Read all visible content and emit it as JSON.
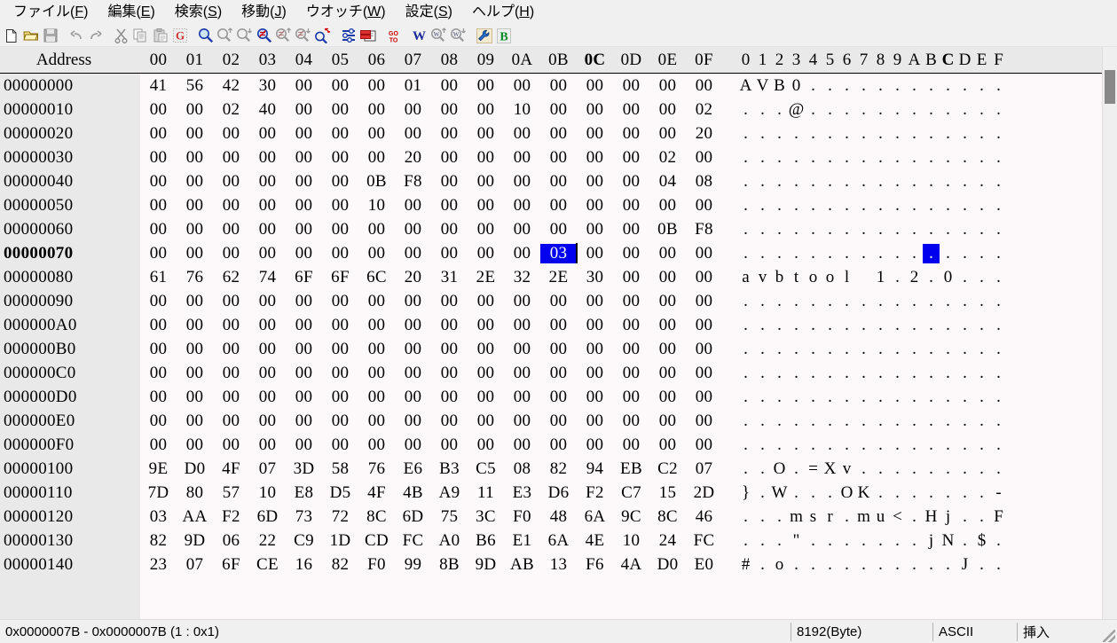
{
  "menu": {
    "items": [
      {
        "label": "ファイル(F)",
        "pre": "ファイル(",
        "mnemonic": "F",
        "post": ")"
      },
      {
        "label": "編集(E)",
        "pre": "編集(",
        "mnemonic": "E",
        "post": ")"
      },
      {
        "label": "検索(S)",
        "pre": "検索(",
        "mnemonic": "S",
        "post": ")"
      },
      {
        "label": "移動(J)",
        "pre": "移動(",
        "mnemonic": "J",
        "post": ")"
      },
      {
        "label": "ウオッチ(W)",
        "pre": "ウオッチ(",
        "mnemonic": "W",
        "post": ")"
      },
      {
        "label": "設定(S)",
        "pre": "設定(",
        "mnemonic": "S",
        "post": ")"
      },
      {
        "label": "ヘルプ(H)",
        "pre": "ヘルプ(",
        "mnemonic": "H",
        "post": ")"
      }
    ]
  },
  "toolbar": {
    "buttons": [
      {
        "icon": "new-file-icon",
        "enabled": true
      },
      {
        "icon": "open-folder-icon",
        "enabled": true
      },
      {
        "icon": "save-icon",
        "enabled": false
      },
      {
        "icon": "undo-icon",
        "enabled": false
      },
      {
        "icon": "redo-icon",
        "enabled": false
      },
      {
        "icon": "cut-icon",
        "enabled": false
      },
      {
        "icon": "copy-icon",
        "enabled": false
      },
      {
        "icon": "paste-icon",
        "enabled": false
      },
      {
        "icon": "grep-g-icon",
        "enabled": false
      },
      {
        "icon": "search-icon",
        "enabled": true
      },
      {
        "icon": "search-up-icon",
        "enabled": false
      },
      {
        "icon": "search-down-icon",
        "enabled": false
      },
      {
        "icon": "search-diff-icon",
        "enabled": true
      },
      {
        "icon": "search-diff-up-icon",
        "enabled": false
      },
      {
        "icon": "search-diff-down-icon",
        "enabled": false
      },
      {
        "icon": "search-replace-icon",
        "enabled": true
      },
      {
        "icon": "compare-lines-icon",
        "enabled": true
      },
      {
        "icon": "insert-block-icon",
        "enabled": true
      },
      {
        "icon": "goto-icon",
        "enabled": true
      },
      {
        "icon": "watch-w-icon",
        "enabled": true
      },
      {
        "icon": "watch-prev-icon",
        "enabled": false
      },
      {
        "icon": "watch-next-icon",
        "enabled": false
      },
      {
        "icon": "settings-wrench-icon",
        "enabled": true
      },
      {
        "icon": "binary-b-icon",
        "enabled": true
      }
    ]
  },
  "hexview": {
    "address_header": "Address",
    "column_headers": [
      "00",
      "01",
      "02",
      "03",
      "04",
      "05",
      "06",
      "07",
      "08",
      "09",
      "0A",
      "0B",
      "0C",
      "0D",
      "0E",
      "0F"
    ],
    "ascii_header": [
      "0",
      "1",
      "2",
      "3",
      "4",
      "5",
      "6",
      "7",
      "8",
      "9",
      "A",
      "B",
      "C",
      "D",
      "E",
      "F"
    ],
    "current_column_index": 12,
    "cursor": {
      "row_index": 7,
      "byte_index": 11,
      "address": "0x0000007B"
    },
    "rows": [
      {
        "addr": "00000000",
        "bytes": [
          "41",
          "56",
          "42",
          "30",
          "00",
          "00",
          "00",
          "01",
          "00",
          "00",
          "00",
          "00",
          "00",
          "00",
          "00",
          "00"
        ],
        "ascii": [
          "A",
          "V",
          "B",
          "0",
          ".",
          ".",
          ".",
          ".",
          ".",
          ".",
          ".",
          ".",
          ".",
          ".",
          ".",
          "."
        ]
      },
      {
        "addr": "00000010",
        "bytes": [
          "00",
          "00",
          "02",
          "40",
          "00",
          "00",
          "00",
          "00",
          "00",
          "00",
          "10",
          "00",
          "00",
          "00",
          "00",
          "02"
        ],
        "ascii": [
          ".",
          ".",
          ".",
          "@",
          ".",
          ".",
          ".",
          ".",
          ".",
          ".",
          ".",
          ".",
          ".",
          ".",
          ".",
          "."
        ]
      },
      {
        "addr": "00000020",
        "bytes": [
          "00",
          "00",
          "00",
          "00",
          "00",
          "00",
          "00",
          "00",
          "00",
          "00",
          "00",
          "00",
          "00",
          "00",
          "00",
          "20"
        ],
        "ascii": [
          ".",
          ".",
          ".",
          ".",
          ".",
          ".",
          ".",
          ".",
          ".",
          ".",
          ".",
          ".",
          ".",
          ".",
          ".",
          "."
        ]
      },
      {
        "addr": "00000030",
        "bytes": [
          "00",
          "00",
          "00",
          "00",
          "00",
          "00",
          "00",
          "20",
          "00",
          "00",
          "00",
          "00",
          "00",
          "00",
          "02",
          "00"
        ],
        "ascii": [
          ".",
          ".",
          ".",
          ".",
          ".",
          ".",
          ".",
          ".",
          ".",
          ".",
          ".",
          ".",
          ".",
          ".",
          ".",
          "."
        ]
      },
      {
        "addr": "00000040",
        "bytes": [
          "00",
          "00",
          "00",
          "00",
          "00",
          "00",
          "0B",
          "F8",
          "00",
          "00",
          "00",
          "00",
          "00",
          "00",
          "04",
          "08"
        ],
        "ascii": [
          ".",
          ".",
          ".",
          ".",
          ".",
          ".",
          ".",
          ".",
          ".",
          ".",
          ".",
          ".",
          ".",
          ".",
          ".",
          "."
        ]
      },
      {
        "addr": "00000050",
        "bytes": [
          "00",
          "00",
          "00",
          "00",
          "00",
          "00",
          "10",
          "00",
          "00",
          "00",
          "00",
          "00",
          "00",
          "00",
          "00",
          "00"
        ],
        "ascii": [
          ".",
          ".",
          ".",
          ".",
          ".",
          ".",
          ".",
          ".",
          ".",
          ".",
          ".",
          ".",
          ".",
          ".",
          ".",
          "."
        ]
      },
      {
        "addr": "00000060",
        "bytes": [
          "00",
          "00",
          "00",
          "00",
          "00",
          "00",
          "00",
          "00",
          "00",
          "00",
          "00",
          "00",
          "00",
          "00",
          "0B",
          "F8"
        ],
        "ascii": [
          ".",
          ".",
          ".",
          ".",
          ".",
          ".",
          ".",
          ".",
          ".",
          ".",
          ".",
          ".",
          ".",
          ".",
          ".",
          "."
        ]
      },
      {
        "addr": "00000070",
        "bytes": [
          "00",
          "00",
          "00",
          "00",
          "00",
          "00",
          "00",
          "00",
          "00",
          "00",
          "00",
          "03",
          "00",
          "00",
          "00",
          "00"
        ],
        "ascii": [
          ".",
          ".",
          ".",
          ".",
          ".",
          ".",
          ".",
          ".",
          ".",
          ".",
          ".",
          ".",
          ".",
          ".",
          ".",
          "."
        ]
      },
      {
        "addr": "00000080",
        "bytes": [
          "61",
          "76",
          "62",
          "74",
          "6F",
          "6F",
          "6C",
          "20",
          "31",
          "2E",
          "32",
          "2E",
          "30",
          "00",
          "00",
          "00"
        ],
        "ascii": [
          "a",
          "v",
          "b",
          "t",
          "o",
          "o",
          "l",
          " ",
          "1",
          ".",
          "2",
          ".",
          "0",
          ".",
          ".",
          "."
        ]
      },
      {
        "addr": "00000090",
        "bytes": [
          "00",
          "00",
          "00",
          "00",
          "00",
          "00",
          "00",
          "00",
          "00",
          "00",
          "00",
          "00",
          "00",
          "00",
          "00",
          "00"
        ],
        "ascii": [
          ".",
          ".",
          ".",
          ".",
          ".",
          ".",
          ".",
          ".",
          ".",
          ".",
          ".",
          ".",
          ".",
          ".",
          ".",
          "."
        ]
      },
      {
        "addr": "000000A0",
        "bytes": [
          "00",
          "00",
          "00",
          "00",
          "00",
          "00",
          "00",
          "00",
          "00",
          "00",
          "00",
          "00",
          "00",
          "00",
          "00",
          "00"
        ],
        "ascii": [
          ".",
          ".",
          ".",
          ".",
          ".",
          ".",
          ".",
          ".",
          ".",
          ".",
          ".",
          ".",
          ".",
          ".",
          ".",
          "."
        ]
      },
      {
        "addr": "000000B0",
        "bytes": [
          "00",
          "00",
          "00",
          "00",
          "00",
          "00",
          "00",
          "00",
          "00",
          "00",
          "00",
          "00",
          "00",
          "00",
          "00",
          "00"
        ],
        "ascii": [
          ".",
          ".",
          ".",
          ".",
          ".",
          ".",
          ".",
          ".",
          ".",
          ".",
          ".",
          ".",
          ".",
          ".",
          ".",
          "."
        ]
      },
      {
        "addr": "000000C0",
        "bytes": [
          "00",
          "00",
          "00",
          "00",
          "00",
          "00",
          "00",
          "00",
          "00",
          "00",
          "00",
          "00",
          "00",
          "00",
          "00",
          "00"
        ],
        "ascii": [
          ".",
          ".",
          ".",
          ".",
          ".",
          ".",
          ".",
          ".",
          ".",
          ".",
          ".",
          ".",
          ".",
          ".",
          ".",
          "."
        ]
      },
      {
        "addr": "000000D0",
        "bytes": [
          "00",
          "00",
          "00",
          "00",
          "00",
          "00",
          "00",
          "00",
          "00",
          "00",
          "00",
          "00",
          "00",
          "00",
          "00",
          "00"
        ],
        "ascii": [
          ".",
          ".",
          ".",
          ".",
          ".",
          ".",
          ".",
          ".",
          ".",
          ".",
          ".",
          ".",
          ".",
          ".",
          ".",
          "."
        ]
      },
      {
        "addr": "000000E0",
        "bytes": [
          "00",
          "00",
          "00",
          "00",
          "00",
          "00",
          "00",
          "00",
          "00",
          "00",
          "00",
          "00",
          "00",
          "00",
          "00",
          "00"
        ],
        "ascii": [
          ".",
          ".",
          ".",
          ".",
          ".",
          ".",
          ".",
          ".",
          ".",
          ".",
          ".",
          ".",
          ".",
          ".",
          ".",
          "."
        ]
      },
      {
        "addr": "000000F0",
        "bytes": [
          "00",
          "00",
          "00",
          "00",
          "00",
          "00",
          "00",
          "00",
          "00",
          "00",
          "00",
          "00",
          "00",
          "00",
          "00",
          "00"
        ],
        "ascii": [
          ".",
          ".",
          ".",
          ".",
          ".",
          ".",
          ".",
          ".",
          ".",
          ".",
          ".",
          ".",
          ".",
          ".",
          ".",
          "."
        ]
      },
      {
        "addr": "00000100",
        "bytes": [
          "9E",
          "D0",
          "4F",
          "07",
          "3D",
          "58",
          "76",
          "E6",
          "B3",
          "C5",
          "08",
          "82",
          "94",
          "EB",
          "C2",
          "07"
        ],
        "ascii": [
          ".",
          ".",
          "O",
          ".",
          "=",
          "X",
          "v",
          ".",
          ".",
          ".",
          ".",
          ".",
          ".",
          ".",
          ".",
          "."
        ]
      },
      {
        "addr": "00000110",
        "bytes": [
          "7D",
          "80",
          "57",
          "10",
          "E8",
          "D5",
          "4F",
          "4B",
          "A9",
          "11",
          "E3",
          "D6",
          "F2",
          "C7",
          "15",
          "2D"
        ],
        "ascii": [
          "}",
          ".",
          "W",
          ".",
          ".",
          ".",
          "O",
          "K",
          ".",
          ".",
          ".",
          ".",
          ".",
          ".",
          ".",
          "-"
        ]
      },
      {
        "addr": "00000120",
        "bytes": [
          "03",
          "AA",
          "F2",
          "6D",
          "73",
          "72",
          "8C",
          "6D",
          "75",
          "3C",
          "F0",
          "48",
          "6A",
          "9C",
          "8C",
          "46"
        ],
        "ascii": [
          ".",
          ".",
          ".",
          "m",
          "s",
          "r",
          ".",
          "m",
          "u",
          "<",
          ".",
          "H",
          "j",
          ".",
          ".",
          "F"
        ]
      },
      {
        "addr": "00000130",
        "bytes": [
          "82",
          "9D",
          "06",
          "22",
          "C9",
          "1D",
          "CD",
          "FC",
          "A0",
          "B6",
          "E1",
          "6A",
          "4E",
          "10",
          "24",
          "FC"
        ],
        "ascii": [
          ".",
          ".",
          ".",
          "\"",
          ".",
          ".",
          ".",
          ".",
          ".",
          ".",
          ".",
          "j",
          "N",
          ".",
          "$",
          "."
        ]
      },
      {
        "addr": "00000140",
        "bytes": [
          "23",
          "07",
          "6F",
          "CE",
          "16",
          "82",
          "F0",
          "99",
          "8B",
          "9D",
          "AB",
          "13",
          "F6",
          "4A",
          "D0",
          "E0"
        ],
        "ascii": [
          "#",
          ".",
          "o",
          ".",
          ".",
          ".",
          ".",
          ".",
          ".",
          ".",
          ".",
          ".",
          ".",
          "J",
          ".",
          "."
        ]
      }
    ]
  },
  "statusbar": {
    "selection": "0x0000007B - 0x0000007B (1 : 0x1)",
    "filesize": "8192(Byte)",
    "encoding": "ASCII",
    "editmode": "挿入"
  }
}
